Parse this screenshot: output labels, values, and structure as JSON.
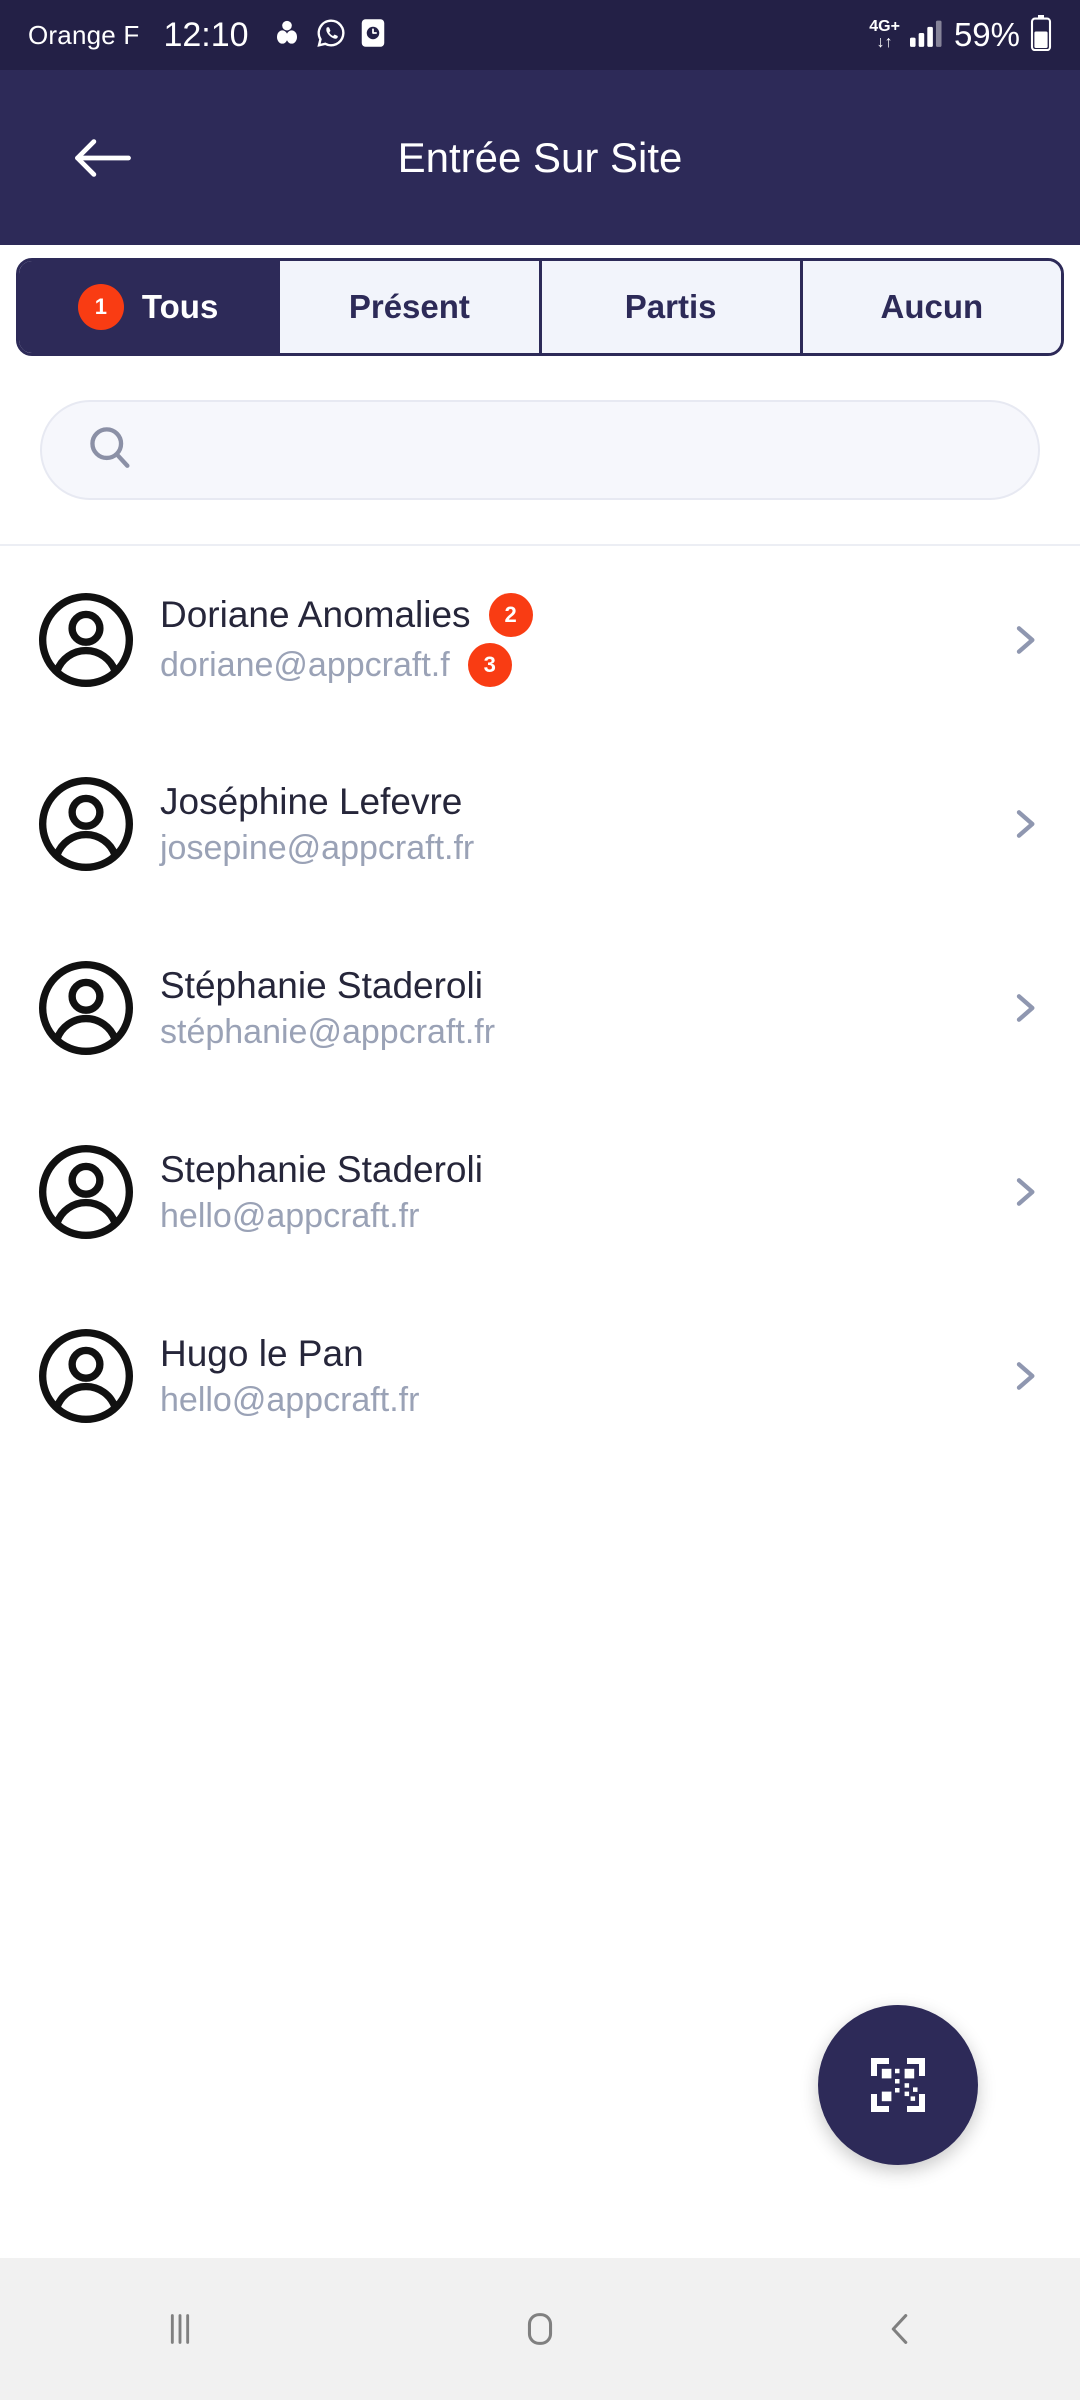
{
  "status_bar": {
    "carrier": "Orange F",
    "time": "12:10",
    "icons": [
      "gallery-icon",
      "whatsapp-icon",
      "app-icon"
    ],
    "network_type": "4G+",
    "network_arrows": "↓↑",
    "battery_percent": "59%",
    "background_color": "#232046"
  },
  "app_bar": {
    "back_label": "back-arrow",
    "title": "Entrée Sur Site",
    "background_color": "#2d2a58"
  },
  "tabs": {
    "items": [
      {
        "label": "Tous",
        "badge": "1",
        "active": true
      },
      {
        "label": "Présent",
        "badge": "",
        "active": false
      },
      {
        "label": "Partis",
        "badge": "",
        "active": false
      },
      {
        "label": "Aucun",
        "badge": "",
        "active": false
      }
    ],
    "badge_color": "#f93c13",
    "active_color": "#2d2a58"
  },
  "search": {
    "value": "",
    "placeholder": "",
    "icon": "search-icon"
  },
  "list": {
    "items": [
      {
        "name": "Doriane Anomalies",
        "email": "doriane@appcraft.f",
        "name_badge": "2",
        "email_badge": "3"
      },
      {
        "name": "Joséphine Lefevre",
        "email": "josepine@appcraft.fr",
        "name_badge": "",
        "email_badge": ""
      },
      {
        "name": "Stéphanie Staderoli",
        "email": "stéphanie@appcraft.fr",
        "name_badge": "",
        "email_badge": ""
      },
      {
        "name": "Stephanie Staderoli",
        "email": "hello@appcraft.fr",
        "name_badge": "",
        "email_badge": ""
      },
      {
        "name": "Hugo le Pan",
        "email": "hello@appcraft.fr",
        "name_badge": "",
        "email_badge": ""
      }
    ]
  },
  "fab": {
    "icon": "qr-code-scan-icon",
    "color": "#2d2a58"
  },
  "nav_bar": {
    "recents": "recents-icon",
    "home": "home-icon",
    "back": "back-icon",
    "background_color": "#f1f1f1"
  }
}
